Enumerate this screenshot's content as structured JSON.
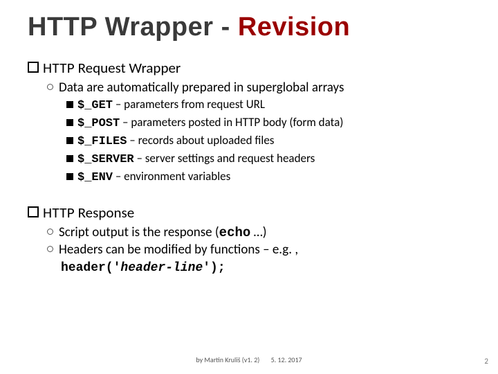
{
  "title": {
    "plain": "HTTP Wrapper ",
    "dash": "- ",
    "accent": "Revision"
  },
  "section1": {
    "heading_prefix": "HTTP",
    "heading_rest": " Request Wrapper",
    "sub": "Data are automatically prepared in superglobal arrays",
    "items": [
      {
        "var": "$_GET",
        "desc": " – parameters from request URL"
      },
      {
        "var": "$_POST",
        "desc": " – parameters posted in HTTP body (form data)"
      },
      {
        "var": "$_FILES",
        "desc": " – records about uploaded files"
      },
      {
        "var": "$_SERVER",
        "desc": " – server settings and request headers"
      },
      {
        "var": "$_ENV",
        "desc": " – environment variables"
      }
    ]
  },
  "section2": {
    "heading_prefix": "HTTP",
    "heading_rest": " Response",
    "subs": [
      {
        "pre": "Script output is the response (",
        "code": "echo",
        "post": " …)"
      },
      {
        "pre": "Headers can be modified by functions – e.g. ,",
        "code": "",
        "post": ""
      }
    ],
    "header_line": {
      "func": "header('",
      "arg": "header-line",
      "close": "');"
    }
  },
  "footer": {
    "author": "by Martin Kruliš (v1. 2)",
    "date": "5. 12. 2017",
    "page": "2"
  }
}
